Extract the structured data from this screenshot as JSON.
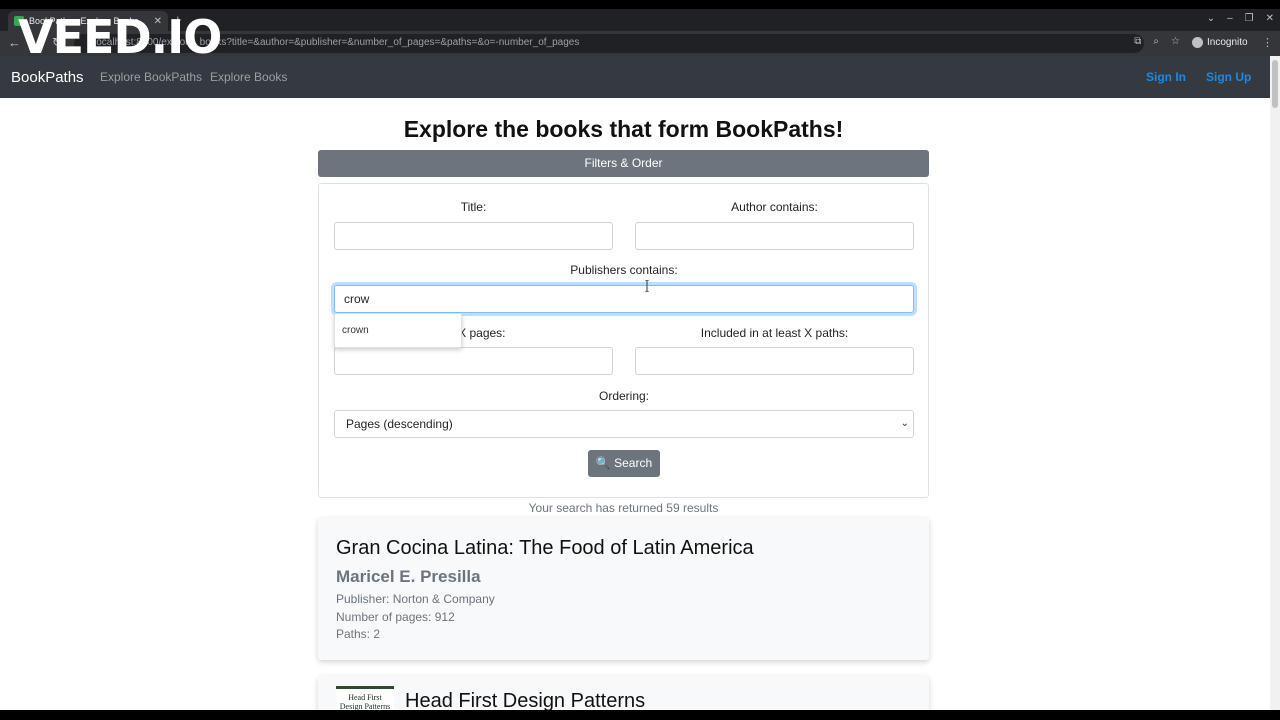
{
  "browser": {
    "tab_title": "BookPaths - Explore Books",
    "url": "localhost:8000/explore_books?title=&author=&publisher=&number_of_pages=&paths=&o=-number_of_pages",
    "profile_label": "Incognito"
  },
  "watermark": "VEED.IO",
  "navbar": {
    "brand": "BookPaths",
    "links": [
      "Explore BookPaths",
      "Explore Books"
    ],
    "sign_in": "Sign In",
    "sign_up": "Sign Up"
  },
  "page": {
    "title": "Explore the books that form BookPaths!",
    "filters_toggle": "Filters & Order"
  },
  "filters": {
    "title_label": "Title:",
    "title_value": "",
    "author_label": "Author contains:",
    "author_value": "",
    "publisher_label": "Publishers contains:",
    "publisher_value": "crow",
    "autocomplete_suggestion": "crown",
    "pages_label_visible": "an X pages:",
    "pages_value": "",
    "paths_label": "Included in at least X paths:",
    "paths_value": "",
    "ordering_label": "Ordering:",
    "ordering_value": "Pages (descending)",
    "search_button": "🔍 Search"
  },
  "results": {
    "count_text": "Your search has returned 59 results",
    "books": [
      {
        "title": "Gran Cocina Latina: The Food of Latin America",
        "author": "Maricel E. Presilla",
        "publisher": "Publisher: Norton & Company",
        "pages": "Number of pages: 912",
        "paths": "Paths: 2"
      },
      {
        "title": "Head First Design Patterns",
        "cover_text": "Head First Design Patterns"
      }
    ]
  },
  "colors": {
    "navbar_bg": "#343a40",
    "secondary": "#6c757d",
    "link_blue": "#1e88e5"
  }
}
